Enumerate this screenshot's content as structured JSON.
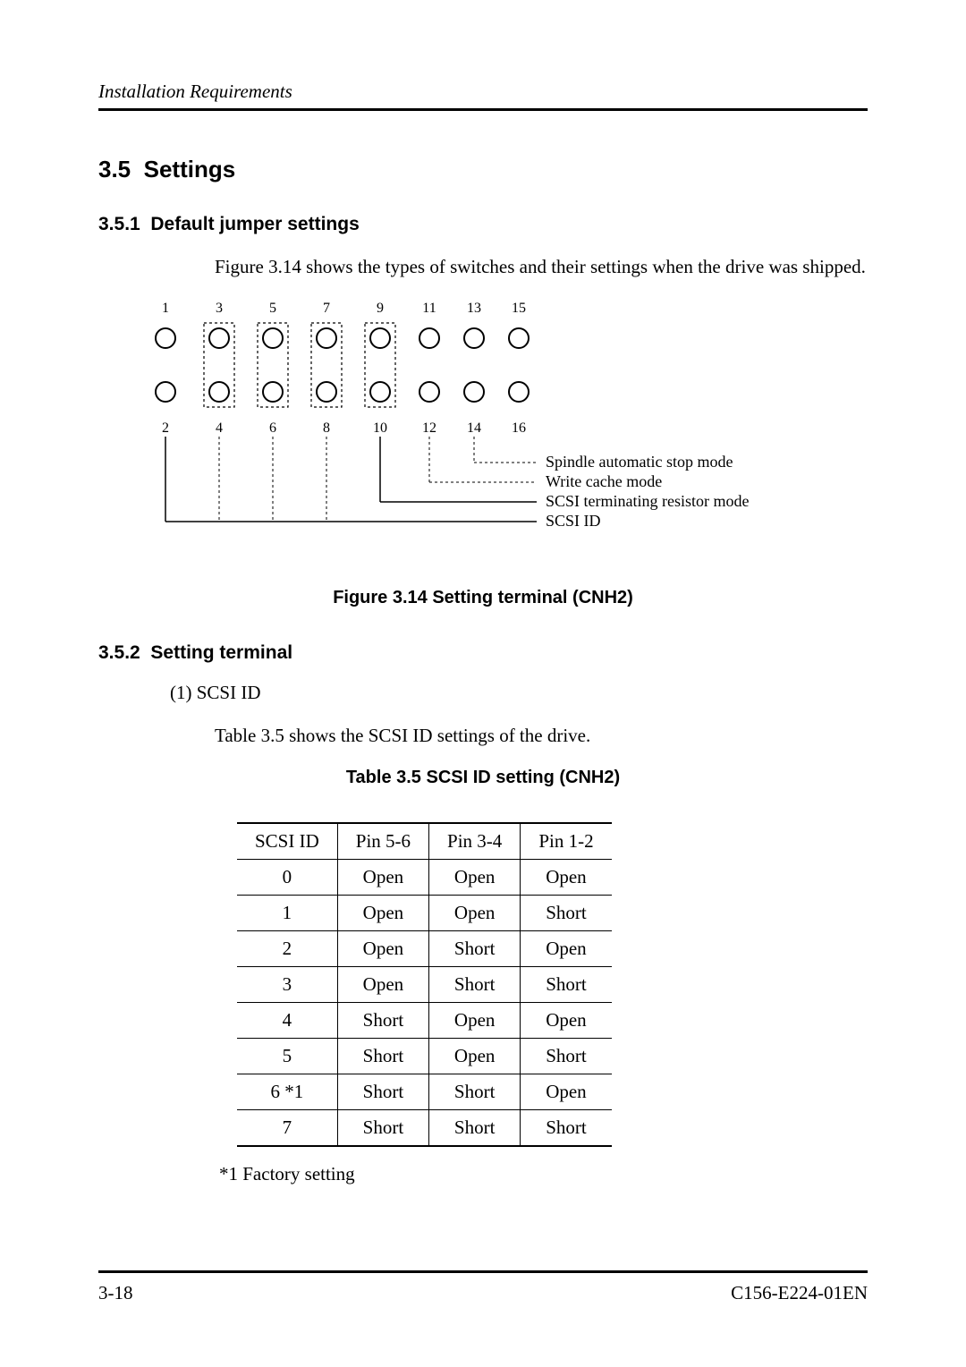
{
  "running_head": "Installation Requirements",
  "section": {
    "num": "3.5",
    "title": "Settings"
  },
  "sub1": {
    "num": "3.5.1",
    "title": "Default jumper settings"
  },
  "para1": "Figure 3.14 shows the types of switches and their settings when the drive was shipped.",
  "figure": {
    "top_labels": [
      "1",
      "3",
      "5",
      "7",
      "9",
      "11",
      "13",
      "15"
    ],
    "bottom_labels": [
      "2",
      "4",
      "6",
      "8",
      "10",
      "12",
      "14",
      "16"
    ],
    "callouts": [
      "Spindle automatic stop mode",
      "Write cache mode",
      "SCSI terminating resistor mode",
      "SCSI ID"
    ],
    "caption": "Figure 3.14  Setting terminal (CNH2)"
  },
  "sub2": {
    "num": "3.5.2",
    "title": "Setting terminal"
  },
  "item1_label": "(1)  SCSI ID",
  "para2": "Table 3.5 shows the SCSI ID settings of the drive.",
  "table": {
    "caption": "Table 3.5  SCSI ID setting (CNH2)",
    "headers": [
      "SCSI ID",
      "Pin 5-6",
      "Pin 3-4",
      "Pin 1-2"
    ],
    "rows": [
      [
        "0",
        "Open",
        "Open",
        "Open"
      ],
      [
        "1",
        "Open",
        "Open",
        "Short"
      ],
      [
        "2",
        "Open",
        "Short",
        "Open"
      ],
      [
        "3",
        "Open",
        "Short",
        "Short"
      ],
      [
        "4",
        "Short",
        "Open",
        "Open"
      ],
      [
        "5",
        "Short",
        "Open",
        "Short"
      ],
      [
        "6 *1",
        "Short",
        "Short",
        "Open"
      ],
      [
        "7",
        "Short",
        "Short",
        "Short"
      ]
    ]
  },
  "footnote": "*1  Factory setting",
  "footer": {
    "left": "3-18",
    "right": "C156-E224-01EN"
  }
}
